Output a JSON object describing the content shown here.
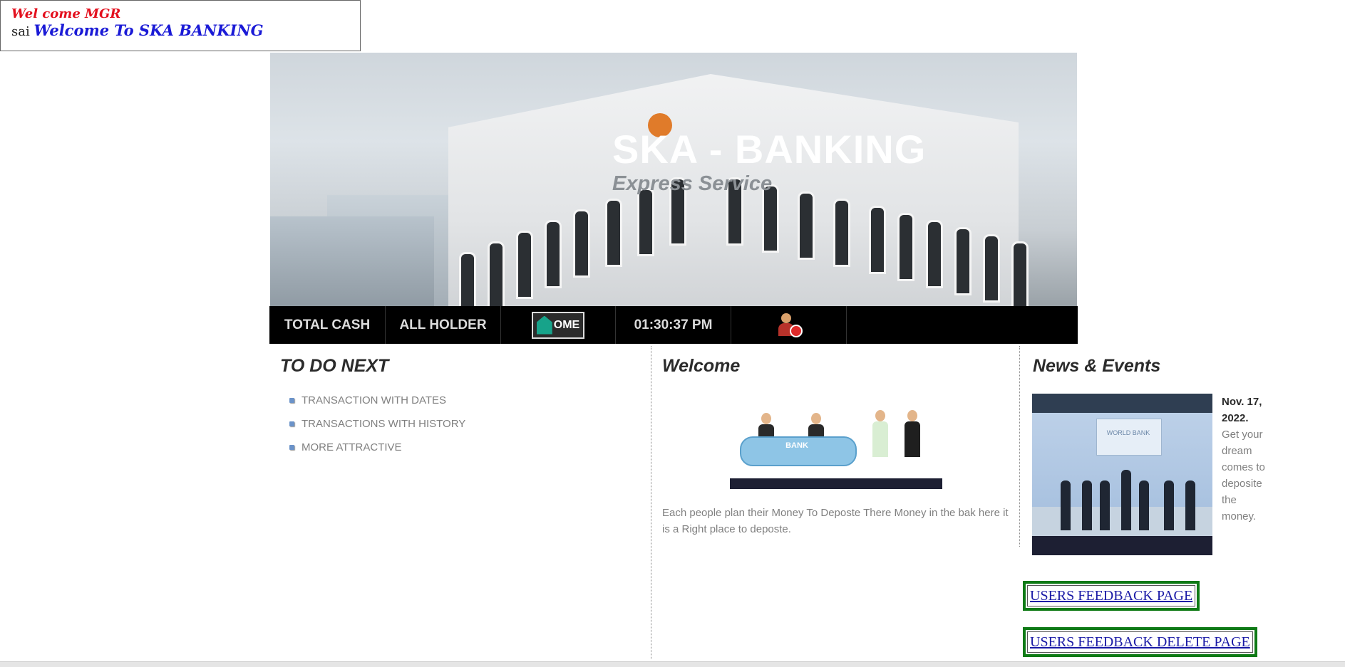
{
  "welcome_box": {
    "line1": "Wel come MGR",
    "user": "sai",
    "greeting": "Welcome To SKA BANKING"
  },
  "banner": {
    "title": "SKA - BANKING",
    "subtitle": "Express Service"
  },
  "nav": {
    "items": [
      {
        "label": "TOTAL CASH"
      },
      {
        "label": "ALL HOLDER"
      },
      {
        "label": "OME",
        "icon": "home-icon"
      },
      {
        "label": "01:30:37 PM"
      },
      {
        "icon": "logout-icon"
      }
    ]
  },
  "todo": {
    "heading": "TO DO NEXT",
    "items": [
      {
        "label": "TRANSACTION WITH DATES"
      },
      {
        "label": "TRANSACTIONS WITH HISTORY"
      },
      {
        "label": "MORE ATTRACTIVE"
      }
    ]
  },
  "welcome": {
    "heading": "Welcome",
    "image_label": "BANK",
    "text": "Each people plan their Money To Deposte There Money in the bak here it is a Right place to deposte."
  },
  "news": {
    "heading": "News & Events",
    "image_label": "WORLD BANK",
    "date": "Nov. 17, 2022.",
    "text": "Get your dream comes to deposite the money."
  },
  "links": {
    "feedback": "USERS FEEDBACK PAGE",
    "feedback_delete": "USERS FEEDBACK DELETE PAGE"
  },
  "colors": {
    "nav_bg": "#000000",
    "link_border": "#0f7a16",
    "welcome_red": "#e3101e",
    "welcome_blue": "#1a1ad6"
  }
}
